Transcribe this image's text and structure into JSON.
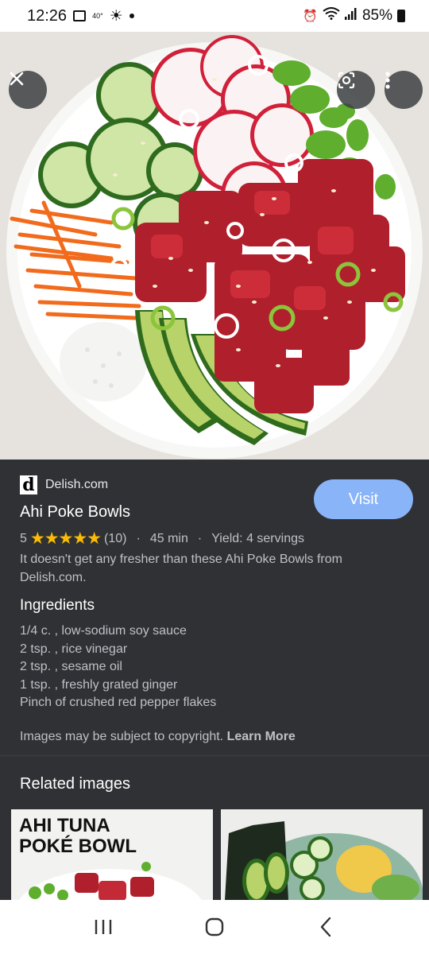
{
  "status_bar": {
    "time": "12:26",
    "temp": "40°",
    "battery": "85%"
  },
  "result": {
    "source_logo": "d",
    "source": "Delish.com",
    "visit_label": "Visit",
    "title": "Ahi Poke Bowls",
    "rating_value": "5",
    "stars": "★★★★★",
    "review_count": "(10)",
    "time": "45 min",
    "yield": "Yield: 4 servings",
    "description": "It doesn't get any fresher than these Ahi Poke Bowls from Delish.com.",
    "ingredients_heading": "Ingredients",
    "ingredients": [
      "1/4 c. , low-sodium soy sauce",
      "2 tsp. , rice vinegar",
      "2 tsp. , sesame oil",
      "1 tsp. , freshly grated ginger",
      "Pinch of crushed red pepper flakes"
    ],
    "copyright_text": "Images may be subject to copyright.",
    "learn_more": "Learn More"
  },
  "related": {
    "heading": "Related images",
    "thumb1_text_line1": "AHI TUNA",
    "thumb1_text_line2": "POKÉ BOWL"
  },
  "colors": {
    "panel_bg": "#303134",
    "accent": "#8ab4f8",
    "star": "#fbbc04"
  }
}
